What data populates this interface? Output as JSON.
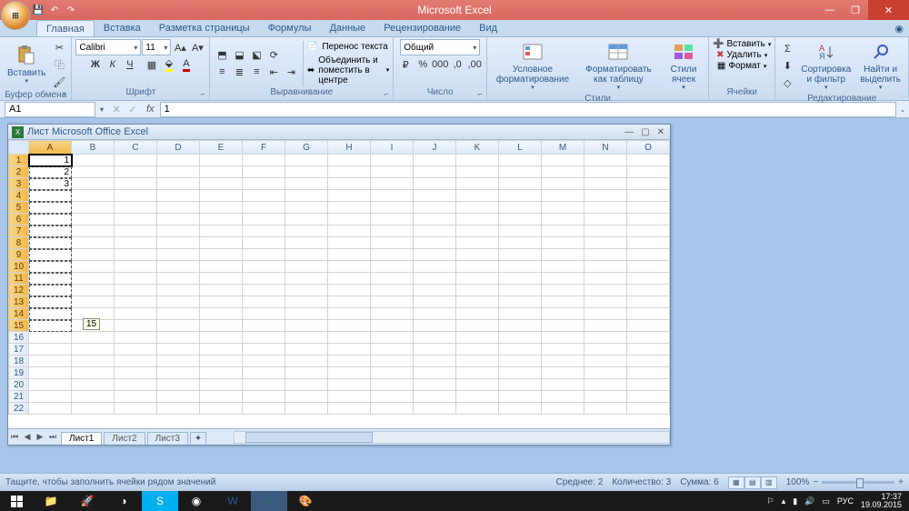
{
  "title": "Microsoft Excel",
  "qat": {
    "save": "💾",
    "undo": "↶",
    "redo": "↷"
  },
  "tabs": [
    "Главная",
    "Вставка",
    "Разметка страницы",
    "Формулы",
    "Данные",
    "Рецензирование",
    "Вид"
  ],
  "activeTab": 0,
  "ribbon": {
    "clipboard": {
      "label": "Буфер обмена",
      "paste": "Вставить"
    },
    "font": {
      "label": "Шрифт",
      "family": "Calibri",
      "size": "11"
    },
    "align": {
      "label": "Выравнивание",
      "wrap": "Перенос текста",
      "merge": "Объединить и поместить в центре"
    },
    "number": {
      "label": "Число",
      "format": "Общий"
    },
    "styles": {
      "label": "Стили",
      "cond": "Условное форматирование",
      "table": "Форматировать как таблицу",
      "cell": "Стили ячеек"
    },
    "cells": {
      "label": "Ячейки",
      "insert": "Вставить",
      "delete": "Удалить",
      "format": "Формат"
    },
    "editing": {
      "label": "Редактирование",
      "sort": "Сортировка и фильтр",
      "find": "Найти и выделить"
    }
  },
  "namebox": "A1",
  "formula": "1",
  "workbook": {
    "title": "Лист Microsoft Office Excel",
    "cols": [
      "A",
      "B",
      "C",
      "D",
      "E",
      "F",
      "G",
      "H",
      "I",
      "J",
      "K",
      "L",
      "M",
      "N",
      "O"
    ],
    "rowCount": 22,
    "visibleCells": {
      "A1": "1",
      "A2": "2",
      "A3": "3"
    },
    "selection": {
      "col": "A",
      "rows": [
        1,
        2,
        3,
        4,
        5,
        6,
        7,
        8,
        9,
        10,
        11,
        12,
        13,
        14,
        15
      ]
    },
    "fillTooltip": "15",
    "sheets": [
      "Лист1",
      "Лист2",
      "Лист3"
    ],
    "activeSheet": 0
  },
  "statusbar": {
    "msg": "Тащите, чтобы заполнить ячейки рядом значений",
    "avg_label": "Среднее:",
    "avg": "2",
    "count_label": "Количество:",
    "count": "3",
    "sum_label": "Сумма:",
    "sum": "6",
    "zoom": "100%"
  },
  "taskbar": {
    "lang": "РУС",
    "time": "17:37",
    "date": "19.09.2015"
  }
}
